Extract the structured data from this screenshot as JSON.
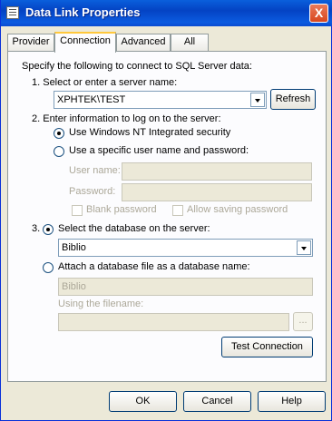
{
  "window": {
    "title": "Data Link Properties",
    "close_glyph": "X"
  },
  "tabs": [
    {
      "label": "Provider"
    },
    {
      "label": "Connection"
    },
    {
      "label": "Advanced"
    },
    {
      "label": "All"
    }
  ],
  "connection": {
    "intro": "Specify the following to connect to SQL Server data:",
    "step1": "1. Select or enter a server name:",
    "server_value": "XPHTEK\\TEST",
    "refresh_label": "Refresh",
    "step2": "2. Enter information to log on to the server:",
    "radio_nt": "Use Windows NT Integrated security",
    "radio_specific": "Use a specific user name and password:",
    "username_label": "User name:",
    "password_label": "Password:",
    "blank_password": "Blank password",
    "allow_saving": "Allow saving password",
    "step3_num": "3.",
    "radio_select_db": "Select the database on the server:",
    "db_value": "Biblio",
    "radio_attach": "Attach a database file as a database name:",
    "attach_value": "Biblio",
    "filename_label": "Using the filename:",
    "browse_label": "...",
    "test_label": "Test Connection"
  },
  "footer": {
    "ok": "OK",
    "cancel": "Cancel",
    "help": "Help"
  }
}
